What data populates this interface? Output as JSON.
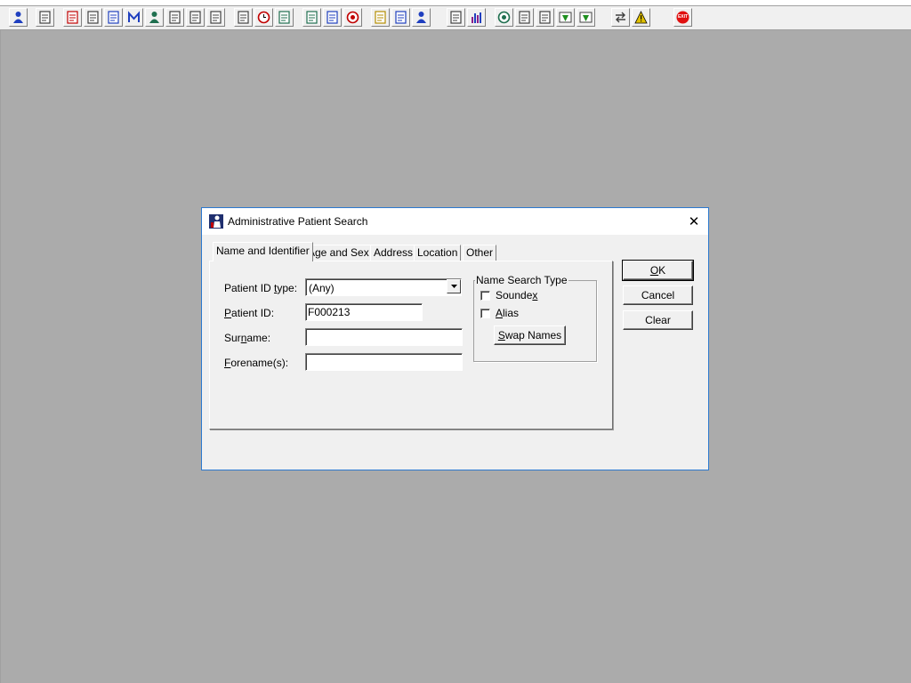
{
  "toolbar": {
    "buttons": [
      {
        "icon": "patient-icon",
        "color": "#1f3fbf"
      },
      {
        "icon": "printer-icon",
        "color": "#404040"
      },
      {
        "icon": "red-book-icon",
        "color": "#c00000"
      },
      {
        "icon": "edit-document-icon",
        "color": "#404040"
      },
      {
        "icon": "image-document-icon",
        "color": "#1f3fbf"
      },
      {
        "icon": "m-letter-icon",
        "color": "#1f3fbf"
      },
      {
        "icon": "doctor-icon",
        "color": "#1f6f4f"
      },
      {
        "icon": "notepad-icon",
        "color": "#404040"
      },
      {
        "icon": "report-icon",
        "color": "#404040"
      },
      {
        "icon": "report-alt-icon",
        "color": "#404040"
      },
      {
        "icon": "search-document-icon",
        "color": "#404040"
      },
      {
        "icon": "clock-icon",
        "color": "#c00000"
      },
      {
        "icon": "monitor-icon",
        "color": "#1f6f4f"
      },
      {
        "icon": "chart-monitor-icon",
        "color": "#1f6f4f"
      },
      {
        "icon": "window-icon",
        "color": "#1f3fbf"
      },
      {
        "icon": "target-icon",
        "color": "#c00000"
      },
      {
        "icon": "sticky-note-icon",
        "color": "#b58e00"
      },
      {
        "icon": "bed-icon",
        "color": "#1f3fbf"
      },
      {
        "icon": "people-icon",
        "color": "#1f3fbf"
      },
      {
        "icon": "blank-document-icon",
        "color": "#404040"
      },
      {
        "icon": "bar-chart-icon",
        "color": "#8a1f8a"
      },
      {
        "icon": "globe-icon",
        "color": "#1f6f4f"
      },
      {
        "icon": "message-icon",
        "color": "#404040"
      },
      {
        "icon": "inbox-icon",
        "color": "#404040"
      },
      {
        "icon": "download-arrow-icon",
        "color": "#1f8f1f"
      },
      {
        "icon": "refresh-arrows-icon",
        "color": "#1f8f1f"
      },
      {
        "icon": "swap-icon",
        "color": "#404040"
      },
      {
        "icon": "warning-icon",
        "color": "#e0c000"
      },
      {
        "icon": "exit-icon",
        "color": "#e01010",
        "text": "EXIT"
      }
    ]
  },
  "dialog": {
    "title": "Administrative Patient Search",
    "close_glyph": "✕",
    "tabs": [
      {
        "label": "Name and Identifier"
      },
      {
        "label": "Age and Sex"
      },
      {
        "label": "Address"
      },
      {
        "label": "Location"
      },
      {
        "label": "Other"
      }
    ],
    "fields": {
      "patient_id_type": {
        "label_pre": "Patient ID ",
        "label_key": "t",
        "label_post": "ype:",
        "value": "(Any)"
      },
      "patient_id": {
        "label_key": "P",
        "label_post": "atient ID:",
        "value": "F000213"
      },
      "surname": {
        "label_pre": "Sur",
        "label_key": "n",
        "label_post": "ame:",
        "value": ""
      },
      "forenames": {
        "label_key": "F",
        "label_post": "orename(s):",
        "value": ""
      }
    },
    "name_search_type": {
      "title": "Name Search Type",
      "soundex": {
        "label_pre": "Sounde",
        "label_key": "x",
        "label_post": "",
        "checked": false
      },
      "alias": {
        "label_pre": "",
        "label_key": "A",
        "label_post": "lias",
        "checked": false
      },
      "swap_button": {
        "label_pre": "",
        "label_key": "S",
        "label_post": "wap Names"
      }
    },
    "buttons": {
      "ok": {
        "label_pre": "",
        "label_key": "O",
        "label_post": "K"
      },
      "cancel": {
        "label": "Cancel"
      },
      "clear": {
        "label": "Clear"
      }
    }
  }
}
